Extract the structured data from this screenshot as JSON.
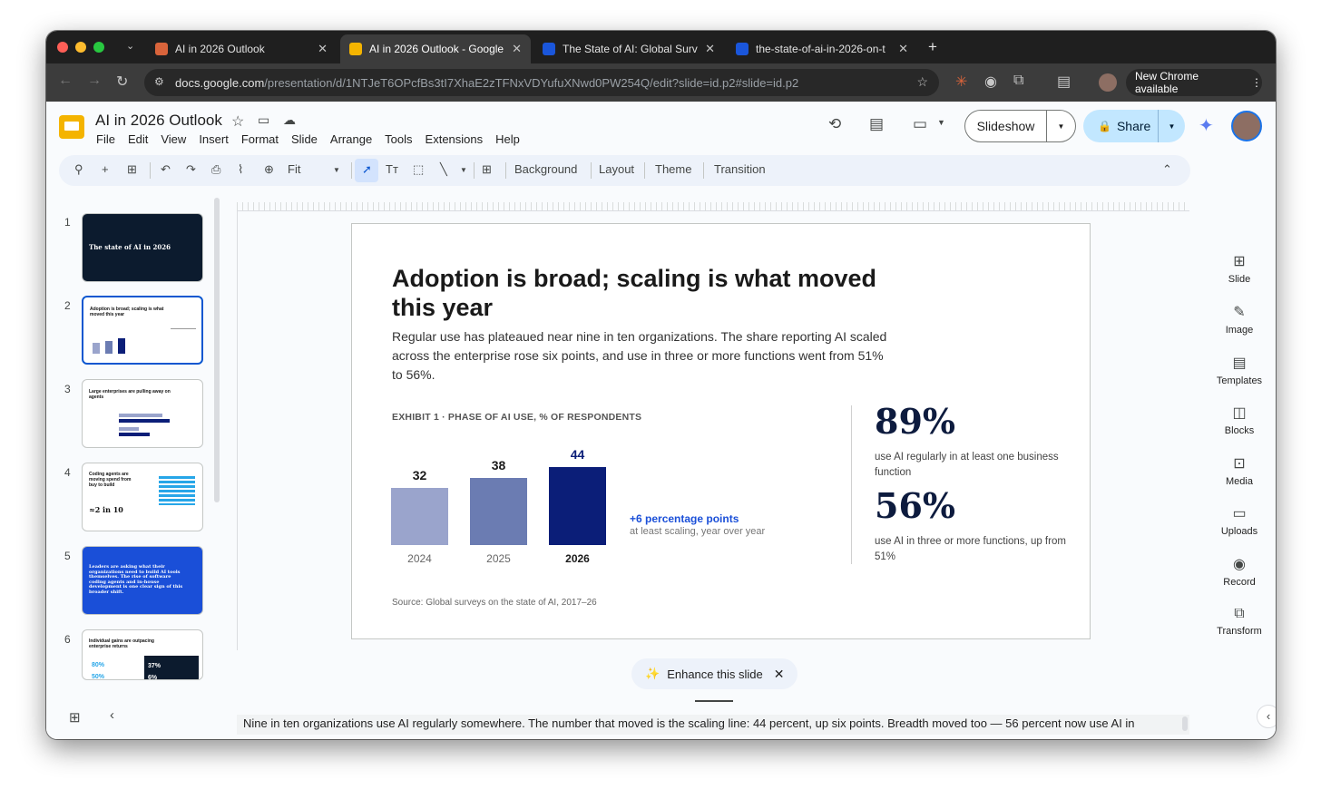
{
  "browser": {
    "tabs": [
      {
        "title": "AI in 2026 Outlook",
        "favicon_color": "#d9643b"
      },
      {
        "title": "AI in 2026 Outlook - Google S",
        "favicon_color": "#f4b400"
      },
      {
        "title": "The State of AI: Global Survey",
        "favicon_color": "#1a56db"
      },
      {
        "title": "the-state-of-ai-in-2026-on-t",
        "favicon_color": "#1a56db"
      }
    ],
    "new_tab": "+",
    "url_host": "docs.google.com",
    "url_path": "/presentation/d/1NTJeT6OPcfBs3tI7XhaE2zTFNxVDYufuXNwd0PW254Q/edit?slide=id.p2#slide=id.p2",
    "update_label": "New Chrome available"
  },
  "app": {
    "title": "AI in 2026 Outlook",
    "menu": [
      "File",
      "Edit",
      "View",
      "Insert",
      "Format",
      "Slide",
      "Arrange",
      "Tools",
      "Extensions",
      "Help"
    ],
    "slideshow_label": "Slideshow",
    "share_label": "Share",
    "toolbar": {
      "zoom": "Fit",
      "background": "Background",
      "layout": "Layout",
      "theme": "Theme",
      "transition": "Transition"
    }
  },
  "filmstrip": [
    {
      "num": "1",
      "title": "The state of AI in 2026"
    },
    {
      "num": "2",
      "title": "Adoption is broad; scaling is what moved this year"
    },
    {
      "num": "3",
      "title": "Large enterprises are pulling away on agents"
    },
    {
      "num": "4",
      "title": "Coding agents are moving spend from buy to build",
      "stat": "≈2 in 10"
    },
    {
      "num": "5",
      "title": "Leaders are asking what their organizations need to build AI tools themselves. The rise of software coding agents and in-house development is one clear sign of this broader shift."
    },
    {
      "num": "6",
      "title": "Individual gains are outpacing enterprise returns",
      "stat_a": "80%",
      "stat_b": "50%",
      "stat_c": "37%",
      "stat_d": "6%"
    }
  ],
  "slide": {
    "headline": "Adoption is broad; scaling is what moved this year",
    "body": "Regular use has plateaued near nine in ten organizations. The share reporting AI scaled across the enterprise rose six points, and use in three or more functions went from 51% to 56%.",
    "exhibit": "EXHIBIT 1 · PHASE OF AI USE, % OF RESPONDENTS",
    "delta_label": "+6 percentage points",
    "delta_sub": "at least scaling, year over year",
    "stat1_value": "89%",
    "stat1_desc": "use AI regularly in at least one business function",
    "stat2_value": "56%",
    "stat2_desc": "use AI in three or more functions, up from 51%",
    "source": "Source: Global surveys on the state of AI, 2017–26"
  },
  "chart_data": {
    "type": "bar",
    "title": "EXHIBIT 1 · PHASE OF AI USE, % OF RESPONDENTS",
    "categories": [
      "2024",
      "2025",
      "2026"
    ],
    "values": [
      32,
      38,
      44
    ],
    "colors": [
      "#9aa4cc",
      "#6b7cb2",
      "#0b1e78"
    ],
    "ylim": [
      0,
      44
    ]
  },
  "right_panel": [
    "Slide",
    "Image",
    "Templates",
    "Blocks",
    "Media",
    "Uploads",
    "Record",
    "Transform"
  ],
  "enhance_label": "Enhance this slide",
  "speaker_notes": "Nine in ten organizations use AI regularly somewhere. The number that moved is the scaling line: 44 percent, up six points. Breadth moved too — 56 percent now use AI in"
}
